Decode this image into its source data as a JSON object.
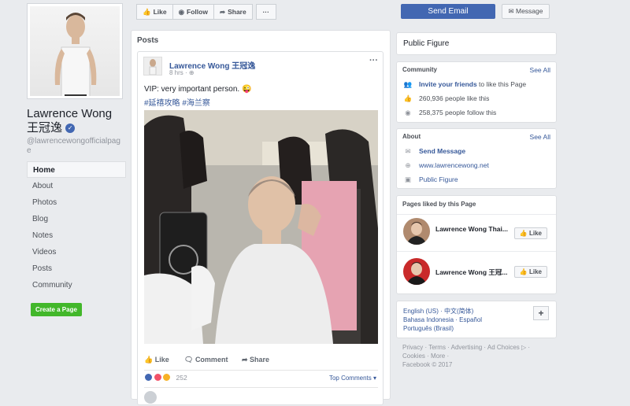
{
  "profile": {
    "name": "Lawrence Wong 王冠逸",
    "handle": "@lawrencewongofficialpage",
    "verified_icon": "✓"
  },
  "nav": {
    "items": [
      "Home",
      "About",
      "Photos",
      "Blog",
      "Notes",
      "Videos",
      "Posts",
      "Community"
    ],
    "create_page": "Create a Page"
  },
  "actions": {
    "like": "Like",
    "follow": "Follow",
    "share": "Share",
    "more": "···",
    "send_email": "Send Email",
    "message": "Message"
  },
  "posts": {
    "section_title": "Posts",
    "author": "Lawrence Wong 王冠逸",
    "time": "8 hrs · ",
    "text": "VIP: very important person. 😜",
    "tags": "#延禧攻略 #海兰察",
    "like": "Like",
    "comment": "Comment",
    "share": "Share",
    "reaction_count": "252",
    "top_comments": "Top Comments ▾"
  },
  "sidebar": {
    "category": "Public Figure",
    "community_title": "Community",
    "see_all": "See All",
    "invite_link": "Invite your friends",
    "invite_rest": " to like this Page",
    "likes": "260,936 people like this",
    "follows": "258,375 people follow this",
    "about_title": "About",
    "send_message": "Send Message",
    "website": "www.lawrencewong.net",
    "category_link": "Public Figure",
    "liked_title": "Pages liked by this Page",
    "liked_pages": [
      {
        "name": "Lawrence Wong Thai...",
        "button": "Like"
      },
      {
        "name": "Lawrence Wong 王冠...",
        "button": "Like"
      }
    ]
  },
  "languages": {
    "line1": "English (US) · 中文(简体)",
    "line2": "Bahasa Indonesia · Español",
    "line3": "Português (Brasil)",
    "plus": "+"
  },
  "footer": {
    "line1": "Privacy · Terms · Advertising · Ad Choices ▷ ·",
    "line2": "Cookies · More ·",
    "line3": "Facebook © 2017"
  },
  "colors": {
    "brand_blue": "#4267b2",
    "link_blue": "#365899",
    "green": "#42b72a",
    "background": "#e9ebee"
  }
}
